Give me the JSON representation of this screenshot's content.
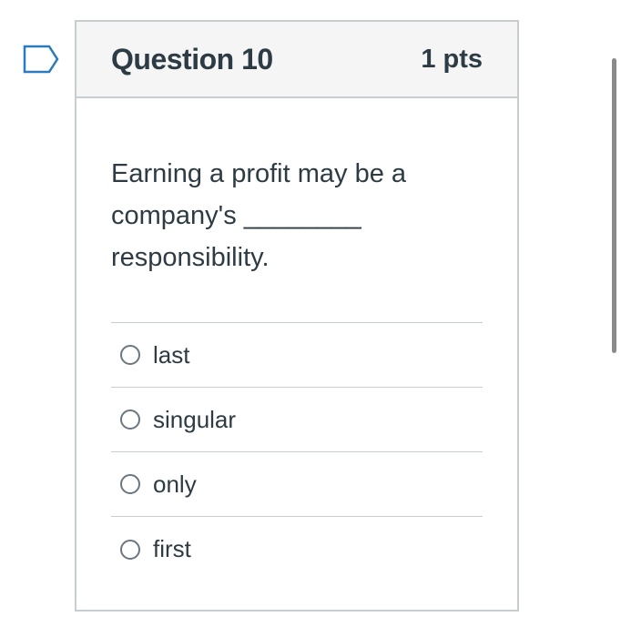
{
  "question": {
    "title": "Question 10",
    "points": "1 pts",
    "text": "Earning a profit may be a company's ________ responsibility."
  },
  "answers": [
    {
      "label": "last"
    },
    {
      "label": "singular"
    },
    {
      "label": "only"
    },
    {
      "label": "first"
    }
  ],
  "icons": {
    "flag": "flag-outline-icon",
    "radio": "radio-unselected-icon"
  },
  "colors": {
    "text": "#2d3b45",
    "header_bg": "#f5f5f5",
    "border": "#c7cdd1",
    "flag": "#2b7abc"
  }
}
